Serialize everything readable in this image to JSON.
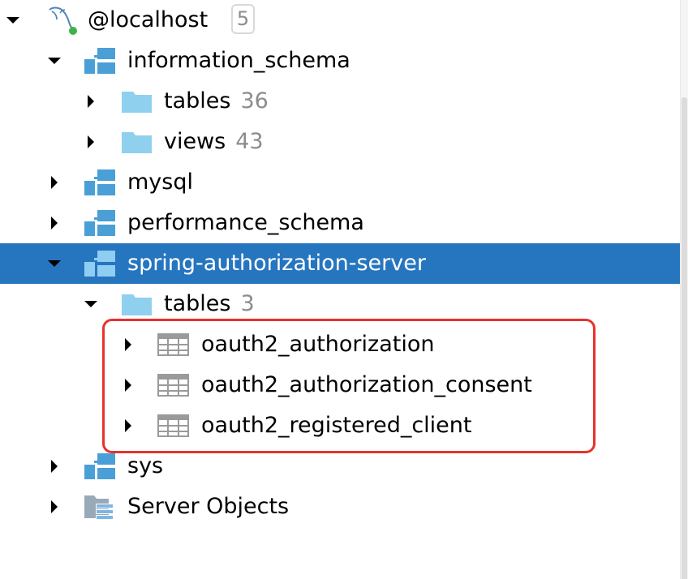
{
  "tree": {
    "host": {
      "label": "@localhost",
      "badge": "5",
      "icon": "mysql-dolphin-icon",
      "status_color": "#3bb54a"
    },
    "information_schema": {
      "label": "information_schema",
      "icon": "schema-icon",
      "children": {
        "tables": {
          "label": "tables",
          "count": "36",
          "icon": "folder-icon"
        },
        "views": {
          "label": "views",
          "count": "43",
          "icon": "folder-icon"
        }
      }
    },
    "mysql": {
      "label": "mysql",
      "icon": "schema-icon"
    },
    "performance_schema": {
      "label": "performance_schema",
      "icon": "schema-icon"
    },
    "spring_authorization_server": {
      "label": "spring-authorization-server",
      "icon": "schema-icon",
      "selected": true,
      "children": {
        "tables": {
          "label": "tables",
          "count": "3",
          "icon": "folder-icon",
          "items": [
            {
              "label": "oauth2_authorization",
              "icon": "table-icon"
            },
            {
              "label": "oauth2_authorization_consent",
              "icon": "table-icon"
            },
            {
              "label": "oauth2_registered_client",
              "icon": "table-icon"
            }
          ]
        }
      }
    },
    "sys": {
      "label": "sys",
      "icon": "schema-icon"
    },
    "server_objects": {
      "label": "Server Objects",
      "icon": "server-objects-icon"
    }
  },
  "colors": {
    "selection": "#2675bf",
    "highlight_border": "#e8322b",
    "folder": "#8fd0ef",
    "schema": "#4a9fd6",
    "count_text": "#8c8c8c"
  }
}
